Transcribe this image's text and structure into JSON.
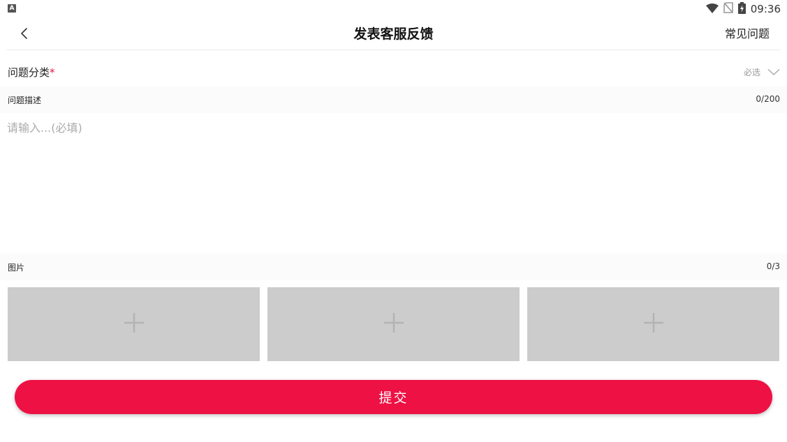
{
  "status_bar": {
    "app_badge": "A",
    "time": "09:36",
    "icons": [
      "wifi-icon",
      "no-sim-icon",
      "battery-charging-icon"
    ]
  },
  "nav": {
    "back_icon": "chevron-left-icon",
    "title": "发表客服反馈",
    "faq_label": "常见问题"
  },
  "category": {
    "label": "问题分类",
    "required_mark": "*",
    "placeholder": "必选",
    "dropdown_icon": "chevron-down-icon"
  },
  "description": {
    "label": "问题描述",
    "count": "0/200",
    "value": "",
    "placeholder": "请输入...(必填)"
  },
  "images": {
    "label": "图片",
    "count": "0/3",
    "slot_icon": "plus-icon"
  },
  "submit": {
    "label": "提交"
  },
  "colors": {
    "accent": "#ee1144",
    "slot_bg": "#cccccc",
    "plus": "#b3b3b3"
  }
}
